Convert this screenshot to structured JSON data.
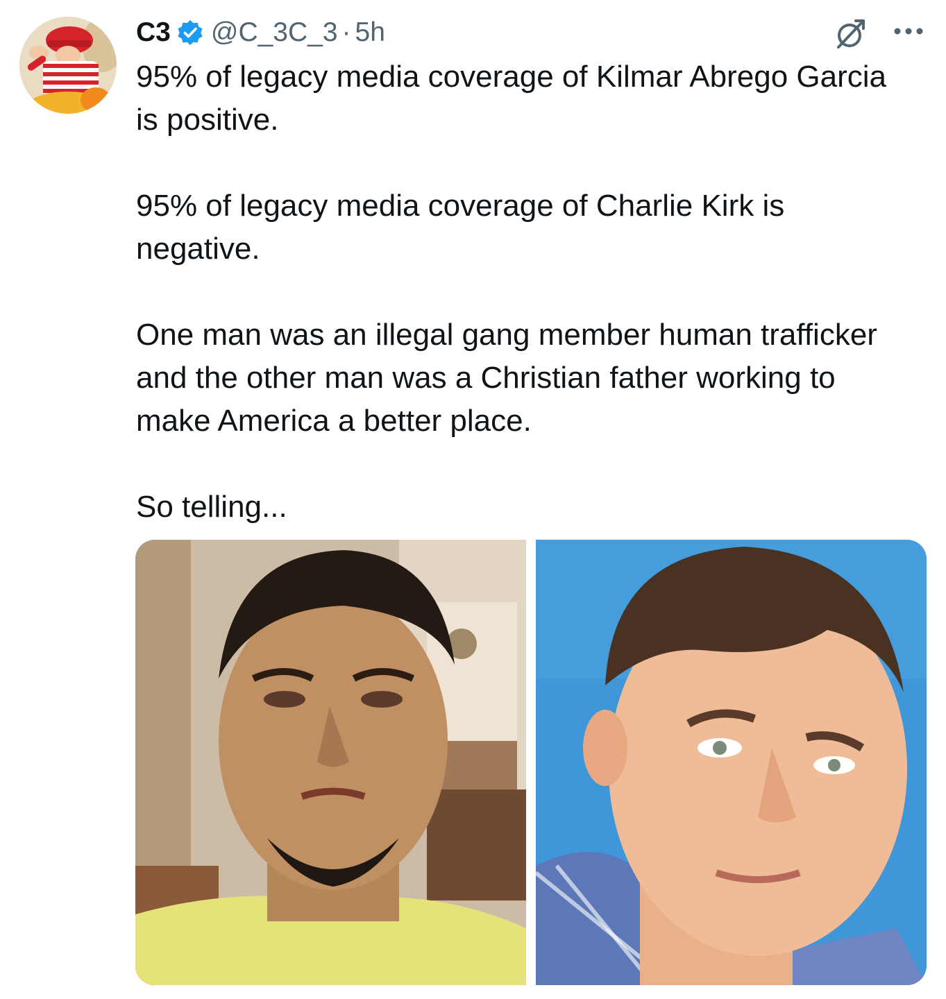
{
  "tweet": {
    "author_name": "C3",
    "author_handle": "@C_3C_3",
    "separator": "·",
    "time_ago": "5h",
    "verified": true,
    "paragraphs": [
      "95% of legacy media coverage of Kilmar Abrego Garcia is positive.",
      "95% of legacy media coverage of Charlie Kirk is negative.",
      "One man was an illegal gang member human trafficker and the other man was a Christian father working to make America a better place.",
      "So telling..."
    ]
  },
  "icons": {
    "verified": "verified-badge-icon",
    "grok": "grok-icon",
    "more": "more-options-icon"
  },
  "colors": {
    "text": "#0f1419",
    "secondary": "#536471",
    "verified_blue": "#1d9bf0"
  }
}
